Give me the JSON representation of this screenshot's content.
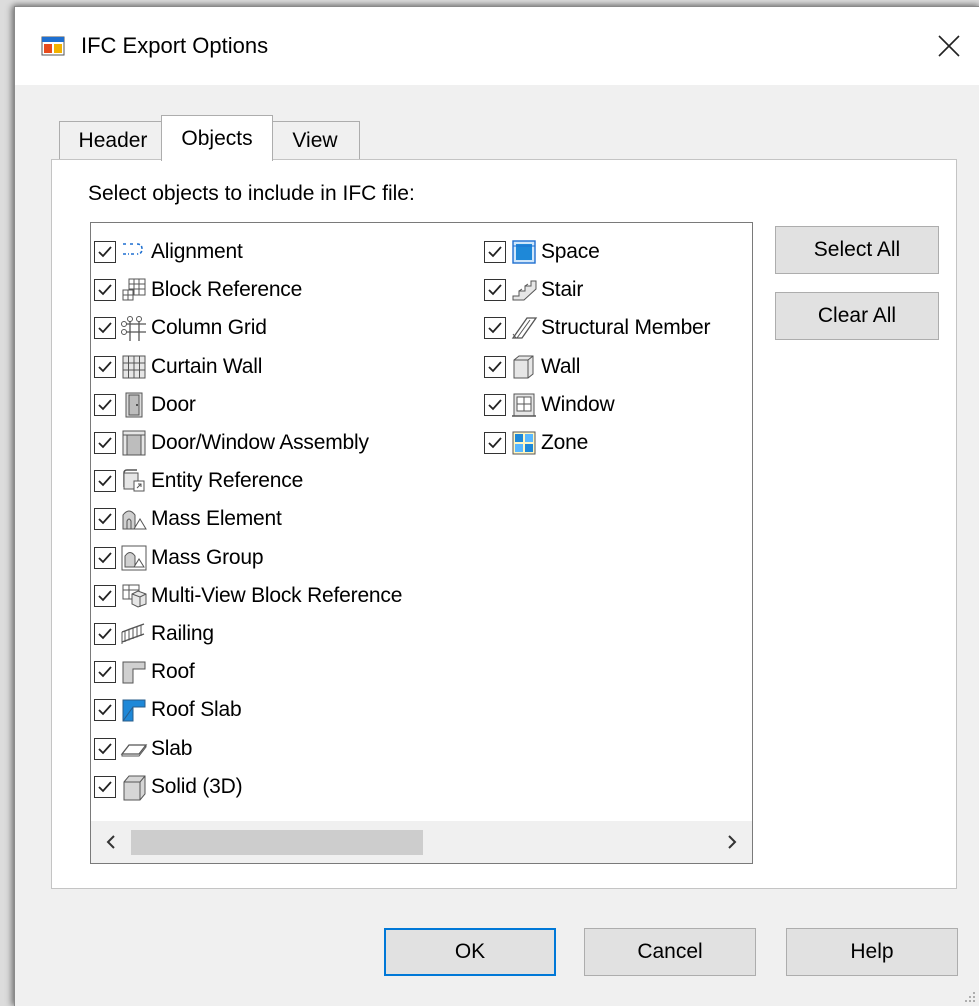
{
  "window": {
    "title": "IFC Export Options"
  },
  "tabs": [
    {
      "label": "Header",
      "active": false
    },
    {
      "label": "Objects",
      "active": true
    },
    {
      "label": "View",
      "active": false
    }
  ],
  "objects_panel": {
    "instruction": "Select objects to include in IFC file:",
    "column1": [
      {
        "label": "Alignment",
        "checked": true,
        "icon": "alignment-icon"
      },
      {
        "label": "Block Reference",
        "checked": true,
        "icon": "block-reference-icon"
      },
      {
        "label": "Column Grid",
        "checked": true,
        "icon": "column-grid-icon"
      },
      {
        "label": "Curtain Wall",
        "checked": true,
        "icon": "curtain-wall-icon"
      },
      {
        "label": "Door",
        "checked": true,
        "icon": "door-icon"
      },
      {
        "label": "Door/Window Assembly",
        "checked": true,
        "icon": "door-window-assembly-icon"
      },
      {
        "label": "Entity Reference",
        "checked": true,
        "icon": "entity-reference-icon"
      },
      {
        "label": "Mass Element",
        "checked": true,
        "icon": "mass-element-icon"
      },
      {
        "label": "Mass Group",
        "checked": true,
        "icon": "mass-group-icon"
      },
      {
        "label": "Multi-View Block Reference",
        "checked": true,
        "icon": "multi-view-block-reference-icon"
      },
      {
        "label": "Railing",
        "checked": true,
        "icon": "railing-icon"
      },
      {
        "label": "Roof",
        "checked": true,
        "icon": "roof-icon"
      },
      {
        "label": "Roof Slab",
        "checked": true,
        "icon": "roof-slab-icon"
      },
      {
        "label": "Slab",
        "checked": true,
        "icon": "slab-icon"
      },
      {
        "label": "Solid (3D)",
        "checked": true,
        "icon": "solid-3d-icon"
      }
    ],
    "column2": [
      {
        "label": "Space",
        "checked": true,
        "icon": "space-icon"
      },
      {
        "label": "Stair",
        "checked": true,
        "icon": "stair-icon"
      },
      {
        "label": "Structural Member",
        "checked": true,
        "icon": "structural-member-icon"
      },
      {
        "label": "Wall",
        "checked": true,
        "icon": "wall-icon"
      },
      {
        "label": "Window",
        "checked": true,
        "icon": "window-icon"
      },
      {
        "label": "Zone",
        "checked": true,
        "icon": "zone-icon"
      }
    ],
    "select_all_label": "Select All",
    "clear_all_label": "Clear All"
  },
  "footer": {
    "ok_label": "OK",
    "cancel_label": "Cancel",
    "help_label": "Help"
  },
  "colors": {
    "accent": "#0078d7",
    "dialog_bg": "#f0f0f0",
    "button_bg": "#e1e1e1",
    "scroll_thumb": "#cdcdcd"
  }
}
